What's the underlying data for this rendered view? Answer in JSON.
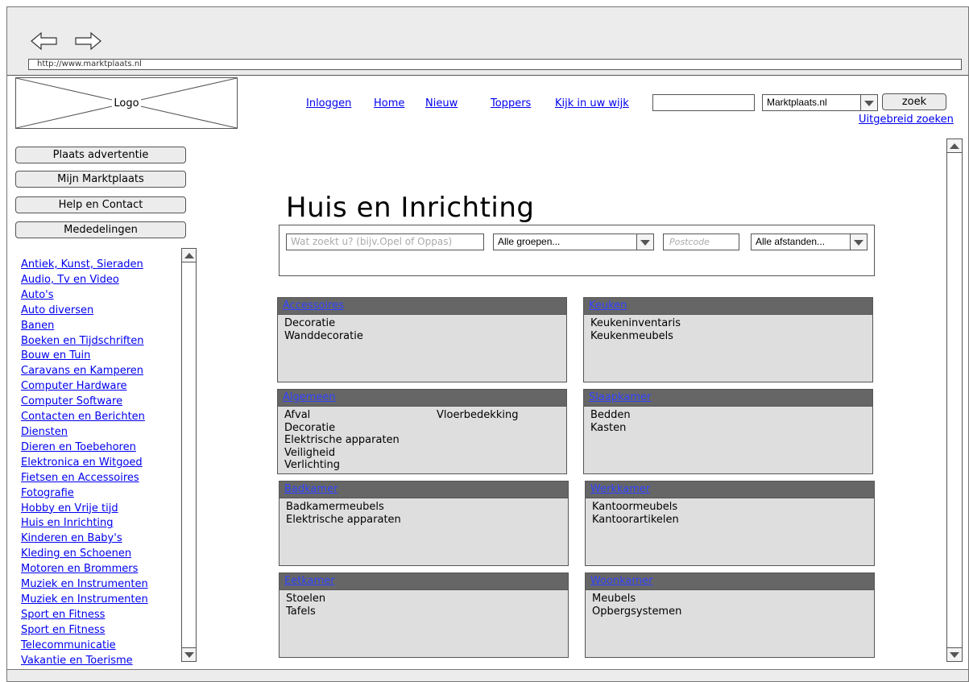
{
  "browser": {
    "url": "http://www.marktplaats.nl",
    "back_icon": "arrow-left-icon",
    "forward_icon": "arrow-right-icon"
  },
  "header": {
    "logo_label": "Logo",
    "nav": [
      "Inloggen",
      "Home",
      "Nieuw",
      "Toppers",
      "Kijk in uw wijk"
    ],
    "search_value": "",
    "site_select": "Marktplaats.nl",
    "search_button": "zoek",
    "advanced_link": "Uitgebreid zoeken"
  },
  "sidebar": {
    "buttons": [
      "Plaats advertentie",
      "Mijn Marktplaats",
      "Help en Contact",
      "Mededelingen"
    ],
    "categories": [
      "Antiek, Kunst, Sieraden",
      "Audio, Tv en Video",
      "Auto's",
      "Auto diversen",
      "Banen",
      "Boeken en Tijdschriften",
      "Bouw en Tuin",
      "Caravans en Kamperen",
      "Computer Hardware",
      "Computer Software",
      "Contacten en Berichten",
      "Diensten",
      "Dieren en Toebehoren",
      "Elektronica en Witgoed",
      "Fietsen en Accessoires",
      "Fotografie",
      "Hobby en Vrije tijd",
      "Huis en Inrichting",
      "Kinderen en Baby's",
      "Kleding en Schoenen",
      "Motoren en Brommers",
      "Muziek en Instrumenten",
      "Muziek en Instrumenten",
      "Sport en Fitness",
      "Sport en Fitness",
      "Telecommunicatie",
      "Vakantie en Toerisme"
    ]
  },
  "main": {
    "title": "Huis en Inrichting",
    "search": {
      "placeholder": "Wat zoekt u? (bijv.Opel of Oppas)",
      "group_select": "Alle groepen...",
      "postcode_placeholder": "Postcode",
      "distance_select": "Alle afstanden..."
    },
    "panels": [
      {
        "title": "Accessoires",
        "items": [
          "Decoratie",
          "Wanddecoratie"
        ],
        "items2": []
      },
      {
        "title": "Keuken",
        "items": [
          "Keukeninventaris",
          "Keukenmeubels"
        ],
        "items2": []
      },
      {
        "title": "Algemeen",
        "items": [
          "Afval",
          "Decoratie",
          "Elektrische apparaten",
          "Veiligheid",
          "Verlichting"
        ],
        "items2": [
          "Vloerbedekking"
        ]
      },
      {
        "title": "Slaapkamer",
        "items": [
          "Bedden",
          "Kasten"
        ],
        "items2": []
      },
      {
        "title": "Badkamer",
        "items": [
          "Badkamermeubels",
          "Elektrische apparaten"
        ],
        "items2": []
      },
      {
        "title": "Werkkamer",
        "items": [
          "Kantoormeubels",
          "Kantoorartikelen"
        ],
        "items2": []
      },
      {
        "title": "Eetkamer",
        "items": [
          "Stoelen",
          "Tafels"
        ],
        "items2": []
      },
      {
        "title": "Woonkamer",
        "items": [
          "Meubels",
          "Opbergsystemen"
        ],
        "items2": []
      }
    ]
  },
  "colors": {
    "link": "#0000ee",
    "panel_header": "#666666",
    "panel_body": "#dedede",
    "chrome": "#ececec"
  }
}
